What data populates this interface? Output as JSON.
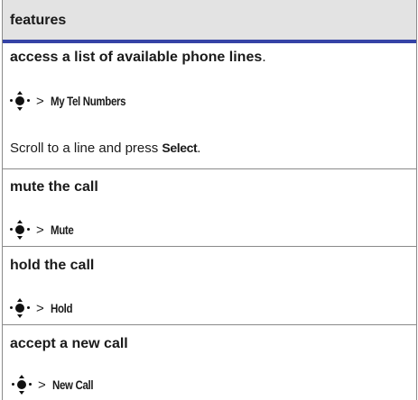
{
  "header": {
    "title": "features"
  },
  "rows": [
    {
      "title": "access a list of available phone lines",
      "title_suffix": ".",
      "path": "My Tel Numbers",
      "note_before": "Scroll to a line and press ",
      "note_bold": "Select",
      "note_after": "."
    },
    {
      "title": "mute the call",
      "path": "Mute"
    },
    {
      "title": "hold the call",
      "path": "Hold"
    },
    {
      "title": "accept a new call",
      "path": "New Call"
    }
  ],
  "symbols": {
    "gt": ">",
    "nav_icon": "nav-key-icon"
  },
  "colors": {
    "header_bg": "#e3e3e3",
    "header_rule": "#3543a6",
    "border": "#8a8a8a"
  }
}
